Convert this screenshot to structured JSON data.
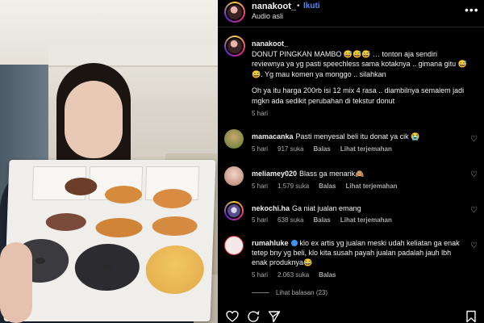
{
  "header": {
    "username": "nanakoot_",
    "separator": "•",
    "follow_label": "Ikuti",
    "audio_label": "Audio asli",
    "more_icon": "more-icon"
  },
  "caption": {
    "username": "nanakoot_",
    "text_p1": "DONUT PINGKAN MAMBO 😅😅😅 … tonton aja sendiri reviewnya ya yg pasti speechless sama kotaknya .. gimana gitu 😅😅. Yg mau komen ya monggo .. silahkan",
    "text_p2": "Oh ya itu harga 200rb isi 12 mix 4 rasa .. diambilnya semalem jadi mgkn ada sedikit perubahan di tekstur donut",
    "time": "5 hari"
  },
  "comments": [
    {
      "username": "mamacanka",
      "text": "Pasti menyesal beli itu donat ya cik 😭",
      "time": "5 hari",
      "likes": "917 suka",
      "reply": "Balas",
      "translate": "Lihat terjemahan"
    },
    {
      "username": "meliamey020",
      "text": "Blass ga menarik🙈",
      "time": "5 hari",
      "likes": "1.579 suka",
      "reply": "Balas",
      "translate": "Lihat terjemahan"
    },
    {
      "username": "nekochi.ha",
      "text": "Ga niat jualan emang",
      "time": "5 hari",
      "likes": "638 suka",
      "reply": "Balas",
      "translate": "Lihat terjemahan"
    },
    {
      "username": "rumahluke",
      "verified": true,
      "text": "klo ex artis yg jualan meski udah keliatan ga enak tetep bny yg beli, klo kita susah payah jualan padalah jauh lbh enak produknya😂",
      "time": "5 hari",
      "likes": "2.063 suka",
      "reply": "Balas"
    }
  ],
  "view_replies": "Lihat balasan (23)",
  "colors": {
    "accent": "#4a8cff",
    "background": "#000000",
    "muted": "#a8a8a8"
  }
}
